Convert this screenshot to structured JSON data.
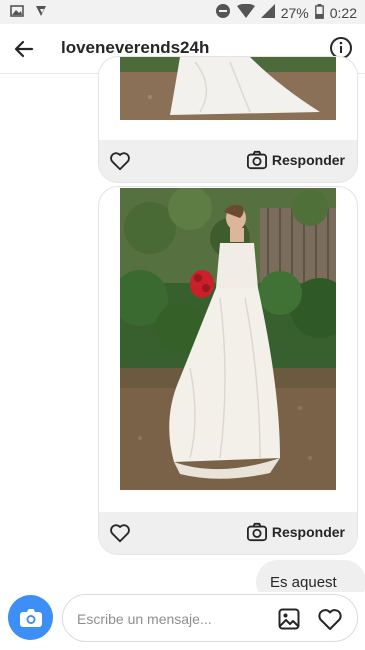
{
  "status_bar": {
    "left_icons": [
      "image-icon",
      "vpn-key-icon"
    ],
    "right_icons": [
      "do-not-disturb-icon",
      "wifi-icon",
      "signal-icon",
      "battery-icon"
    ],
    "battery": "27%",
    "time": "0:22"
  },
  "header": {
    "title": "loveneverends24h",
    "back_icon": "arrow-left-icon",
    "info_icon": "info-icon"
  },
  "messages": [
    {
      "type": "shared-post",
      "content": "wedding-dress-photo",
      "reply_label": "Responder"
    },
    {
      "type": "shared-post",
      "content": "wedding-dress-photo-woman-with-red-bouquet",
      "reply_label": "Responder"
    },
    {
      "type": "outgoing-text",
      "text": "Es aquest"
    }
  ],
  "composer": {
    "placeholder": "Escribe un mensaje...",
    "camera_icon": "camera-icon",
    "gallery_icon": "gallery-icon",
    "like_icon": "heart-icon"
  },
  "colors": {
    "accent": "#3d8ff5",
    "bubble": "#efefef",
    "text": "#262626",
    "placeholder": "#8e8e8e"
  }
}
